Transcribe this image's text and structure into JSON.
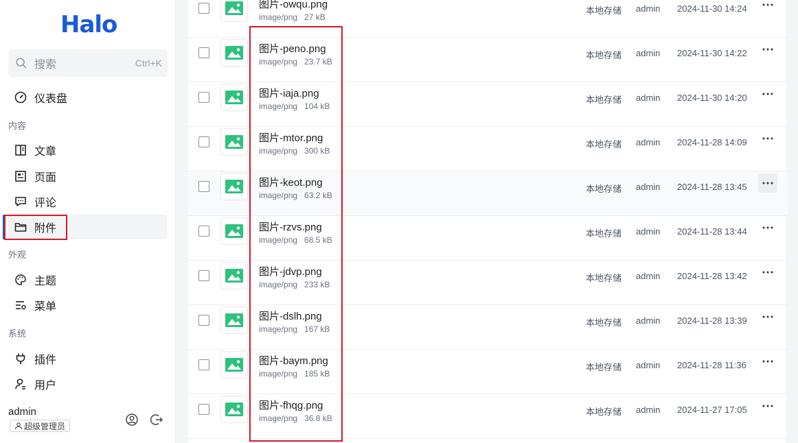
{
  "brand": {
    "logo_text": "Halo",
    "color": "#1a5bd6"
  },
  "search": {
    "placeholder": "搜索",
    "shortcut": "Ctrl+K"
  },
  "sidebar": {
    "dashboard": "仪表盘",
    "section_content": "内容",
    "posts": "文章",
    "pages": "页面",
    "comments": "评论",
    "attachments": "附件",
    "section_appearance": "外观",
    "themes": "主题",
    "menus": "菜单",
    "section_system": "系统",
    "plugins": "插件",
    "users": "用户",
    "active_item": "附件"
  },
  "user": {
    "name": "admin",
    "role": "超级管理员"
  },
  "files": [
    {
      "name": "图片-owqu.png",
      "type": "image/png",
      "size": "27 kB",
      "storage": "本地存储",
      "owner": "admin",
      "date": "2024-11-30 14:24"
    },
    {
      "name": "图片-peno.png",
      "type": "image/png",
      "size": "23.7 kB",
      "storage": "本地存储",
      "owner": "admin",
      "date": "2024-11-30 14:22"
    },
    {
      "name": "图片-iaja.png",
      "type": "image/png",
      "size": "104 kB",
      "storage": "本地存储",
      "owner": "admin",
      "date": "2024-11-30 14:20"
    },
    {
      "name": "图片-mtor.png",
      "type": "image/png",
      "size": "300 kB",
      "storage": "本地存储",
      "owner": "admin",
      "date": "2024-11-28 14:09"
    },
    {
      "name": "图片-keot.png",
      "type": "image/png",
      "size": "63.2 kB",
      "storage": "本地存储",
      "owner": "admin",
      "date": "2024-11-28 13:45"
    },
    {
      "name": "图片-rzvs.png",
      "type": "image/png",
      "size": "68.5 kB",
      "storage": "本地存储",
      "owner": "admin",
      "date": "2024-11-28 13:44"
    },
    {
      "name": "图片-jdvp.png",
      "type": "image/png",
      "size": "233 kB",
      "storage": "本地存储",
      "owner": "admin",
      "date": "2024-11-28 13:42"
    },
    {
      "name": "图片-dslh.png",
      "type": "image/png",
      "size": "167 kB",
      "storage": "本地存储",
      "owner": "admin",
      "date": "2024-11-28 13:39"
    },
    {
      "name": "图片-baym.png",
      "type": "image/png",
      "size": "185 kB",
      "storage": "本地存储",
      "owner": "admin",
      "date": "2024-11-28 11:36"
    },
    {
      "name": "图片-fhqg.png",
      "type": "image/png",
      "size": "36.8 kB",
      "storage": "本地存储",
      "owner": "admin",
      "date": "2024-11-27 17:05"
    }
  ],
  "colors": {
    "annotation": "#d11a2a",
    "thumb_green": "#2ec27e"
  }
}
